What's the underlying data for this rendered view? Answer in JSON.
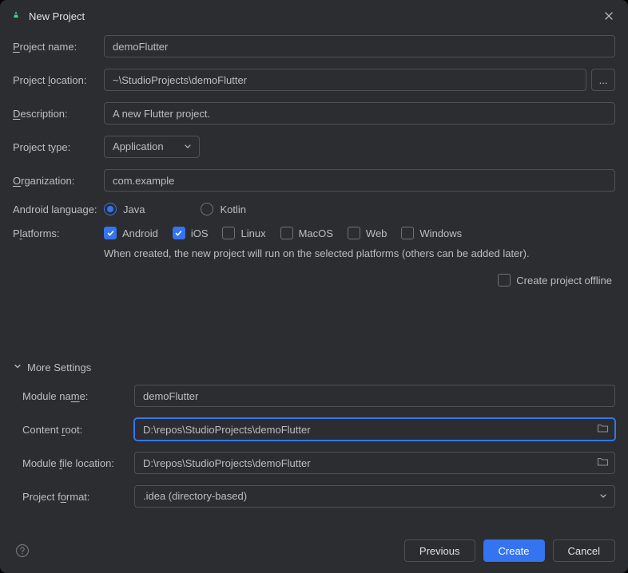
{
  "window": {
    "title": "New Project"
  },
  "labels": {
    "project_name": "Project name:",
    "project_location": "Project location:",
    "description": "Description:",
    "project_type": "Project type:",
    "organization": "Organization:",
    "android_language": "Android language:",
    "platforms": "Platforms:",
    "more_settings": "More Settings",
    "module_name": "Module name:",
    "content_root": "Content root:",
    "module_file_location": "Module file location:",
    "project_format": "Project format:"
  },
  "fields": {
    "project_name": "demoFlutter",
    "project_location": "~\\StudioProjects\\demoFlutter",
    "description": "A new Flutter project.",
    "project_type": "Application",
    "organization": "com.example",
    "module_name": "demoFlutter",
    "content_root": "D:\\repos\\StudioProjects\\demoFlutter",
    "module_file_location": "D:\\repos\\StudioProjects\\demoFlutter",
    "project_format": ".idea (directory-based)"
  },
  "languages": {
    "java": "Java",
    "kotlin": "Kotlin"
  },
  "platforms": {
    "android": "Android",
    "ios": "iOS",
    "linux": "Linux",
    "macos": "MacOS",
    "web": "Web",
    "windows": "Windows"
  },
  "hints": {
    "platforms": "When created, the new project will run on the selected platforms (others can be added later).",
    "offline": "Create project offline"
  },
  "buttons": {
    "browse": "...",
    "previous": "Previous",
    "create": "Create",
    "cancel": "Cancel"
  }
}
